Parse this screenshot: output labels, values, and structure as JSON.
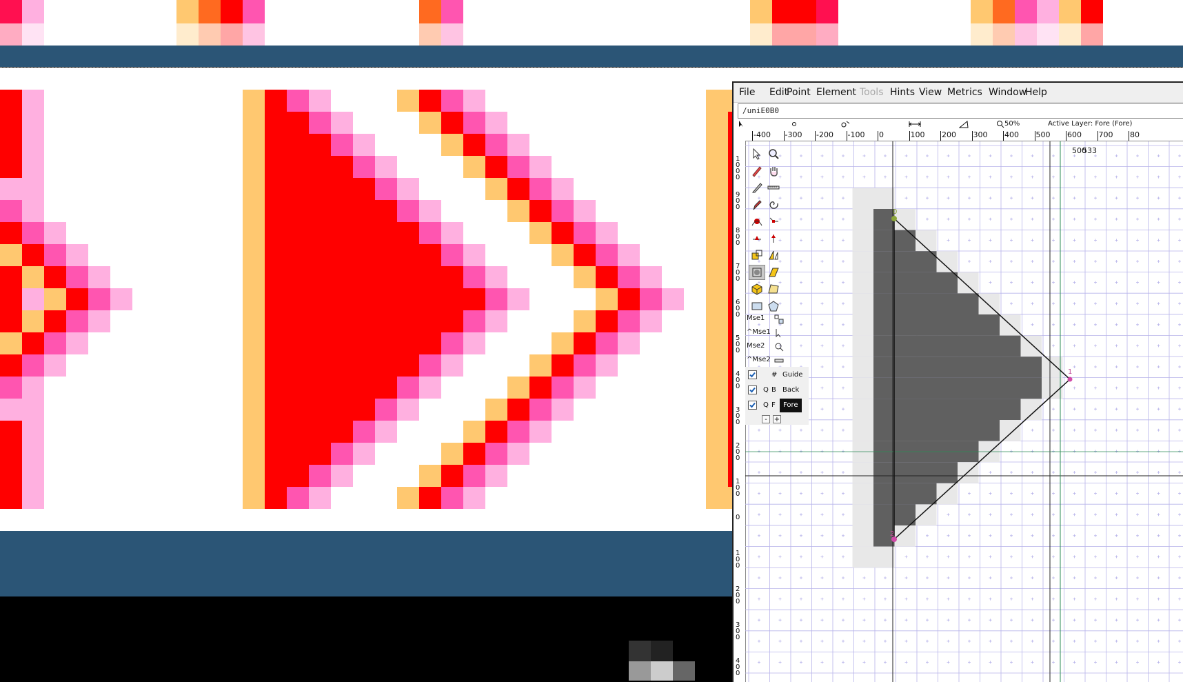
{
  "colors": {
    "band_blue": "#2b5576",
    "pixel_red": "#ff0000",
    "pixel_crimson": "#ff1050",
    "pixel_pink": "#ff55b0",
    "pixel_light_pink": "#ffb0e0",
    "pixel_orange": "#ff6a20",
    "pixel_peach": "#ffc870",
    "glyph_gray": "#606060",
    "glyph_light": "#e8e8e8",
    "grid_blue": "#b7b3ea"
  },
  "menubar": {
    "file": "File",
    "edit": "Edit",
    "point": "Point",
    "element": "Element",
    "tools": "Tools",
    "hints": "Hints",
    "view": "View",
    "metrics": "Metrics",
    "window": "Window",
    "help": "Help"
  },
  "glyph_name": "/uniE0B0",
  "ruler_info": {
    "zoom": "50%",
    "active_layer": "Active Layer: Fore (Fore)"
  },
  "hruler_ticks": [
    "-400",
    "-300",
    "-200",
    "-100",
    "0",
    "100",
    "200",
    "300",
    "400",
    "500",
    "600",
    "700",
    "80"
  ],
  "vruler_ticks": [
    "1\n0\n0\n0",
    "9\n0\n0",
    "8\n0\n0",
    "7\n0\n0",
    "6\n0\n0",
    "5\n0\n0",
    "4\n0\n0",
    "3\n0\n0",
    "2\n0\n0",
    "1\n0\n0",
    "0",
    "1\n0\n0",
    "2\n0\n0",
    "3\n0\n0",
    "4\n0\n0"
  ],
  "advance_label": "500",
  "cursor_label": "533",
  "point_labels": {
    "top": "0",
    "bottom": "2",
    "right": "1"
  },
  "mouse_bindings": [
    "Mse1",
    "^Mse1",
    "Mse2",
    "^Mse2"
  ],
  "layers": [
    {
      "checked": true,
      "q": "",
      "code": "#",
      "name": "Guide"
    },
    {
      "checked": true,
      "q": "Q",
      "code": "B",
      "name": "Back"
    },
    {
      "checked": true,
      "q": "Q",
      "code": "F",
      "name": "Fore"
    }
  ],
  "layer_buttons": {
    "remove": "-",
    "add": "+"
  },
  "tools": [
    "pointer-tool",
    "magnify-tool",
    "freehand-tool",
    "scroll-hand-tool",
    "knife-tool",
    "ruler-tool",
    "pen-tool",
    "spiro-tool",
    "curve-point-tool",
    "corner-point-tool",
    "tangent-point-tool",
    "hv-curve-tool",
    "scale-tool",
    "flip-tool",
    "rotate-tool",
    "skew-tool",
    "3d-rotate-tool",
    "perspective-tool",
    "rectangle-tool",
    "polygon-tool"
  ]
}
